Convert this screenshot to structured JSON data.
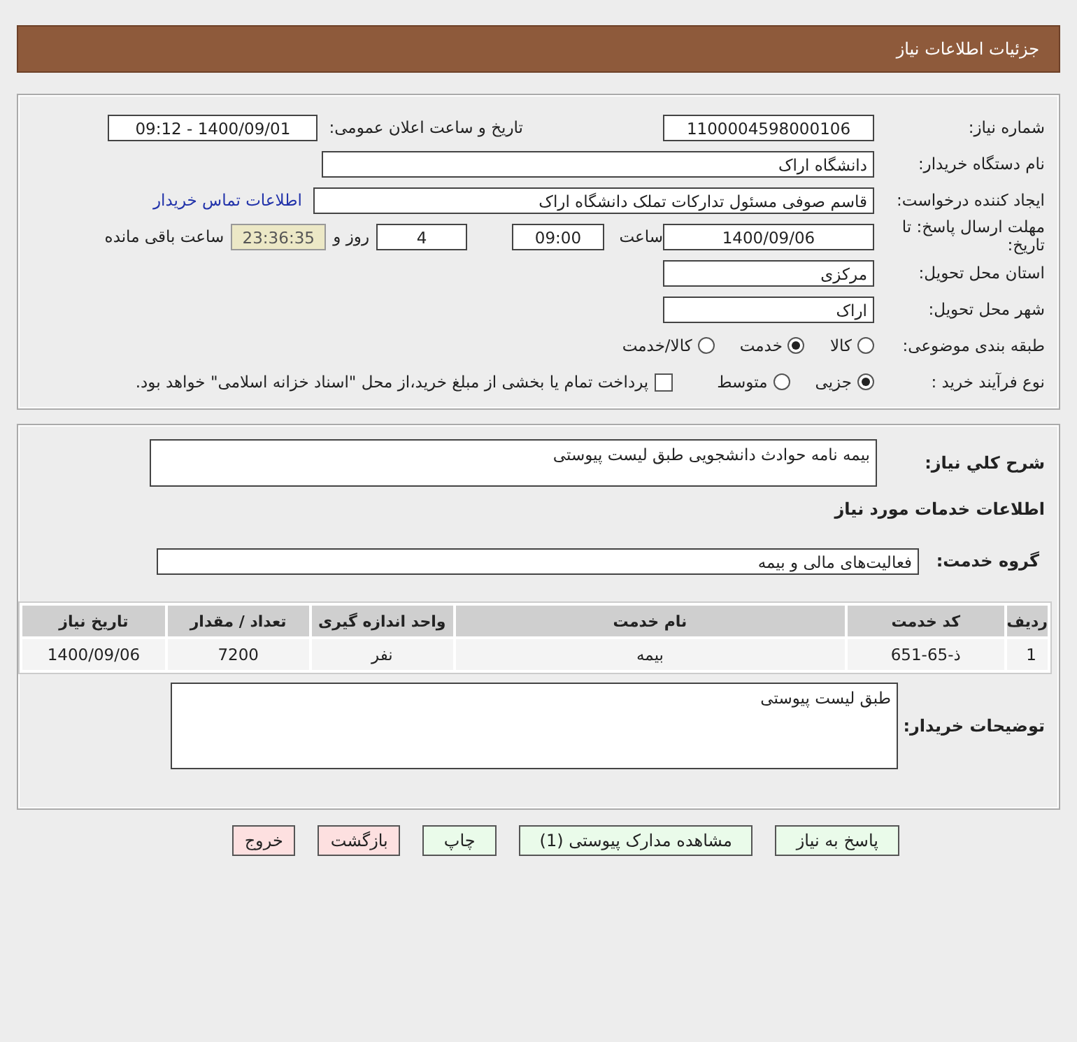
{
  "header": {
    "title": "جزئیات اطلاعات نیاز"
  },
  "details": {
    "need_number": {
      "label": "شماره نیاز:",
      "value": "1100004598000106"
    },
    "announce": {
      "label": "تاریخ و ساعت اعلان عمومی:",
      "value": "1400/09/01 - 09:12"
    },
    "buyer": {
      "label": "نام دستگاه خریدار:",
      "value": "دانشگاه اراک"
    },
    "creator": {
      "label": "ایجاد کننده درخواست:",
      "value": "قاسم صوفی مسئول تدارکات تملک دانشگاه اراک",
      "link": "اطلاعات تماس خریدار"
    },
    "deadline": {
      "label": "مهلت ارسال پاسخ: تا تاریخ:",
      "date": "1400/09/06",
      "time_label": "ساعت",
      "time": "09:00",
      "days": "4",
      "days_label": "روز و",
      "remaining": "23:36:35",
      "remaining_label": "ساعت باقی مانده"
    },
    "province": {
      "label": "استان محل تحویل:",
      "value": "مرکزی"
    },
    "city": {
      "label": "شهر محل تحویل:",
      "value": "اراک"
    },
    "category": {
      "label": "طبقه بندی موضوعی:",
      "options": [
        {
          "label": "کالا",
          "selected": false
        },
        {
          "label": "خدمت",
          "selected": true
        },
        {
          "label": "کالا/خدمت",
          "selected": false
        }
      ]
    },
    "process": {
      "label": "نوع فرآیند خرید :",
      "options": [
        {
          "label": "جزیی",
          "selected": true
        },
        {
          "label": "متوسط",
          "selected": false
        }
      ],
      "payment": {
        "label": "پرداخت تمام یا بخشی از مبلغ خرید،از محل \"اسناد خزانه اسلامی\" خواهد بود.",
        "checked": false
      }
    }
  },
  "services": {
    "description": {
      "label": "شرح كلي نیاز:",
      "value": "بیمه نامه حوادث دانشجویی طبق لیست پیوستی"
    },
    "heading": "اطلاعات خدمات مورد نیاز",
    "group": {
      "label": "گروه خدمت:",
      "value": "فعالیت‌های مالی و بیمه"
    },
    "table": {
      "columns": [
        "ردیف",
        "کد خدمت",
        "نام خدمت",
        "واحد اندازه گیری",
        "تعداد / مقدار",
        "تاریخ نیاز"
      ],
      "rows": [
        [
          "1",
          "ذ-65-651",
          "بیمه",
          "نفر",
          "7200",
          "1400/09/06"
        ]
      ]
    },
    "notes": {
      "label": "توضیحات خریدار:",
      "value": "طبق لیست پیوستی"
    }
  },
  "buttons": [
    {
      "label": "پاسخ به نیاز",
      "kind": "action"
    },
    {
      "label": "مشاهده مدارک پیوستی (1)",
      "kind": "action"
    },
    {
      "label": "چاپ",
      "kind": "action"
    },
    {
      "label": "بازگشت",
      "kind": "cancel"
    },
    {
      "label": "خروج",
      "kind": "cancel"
    }
  ]
}
